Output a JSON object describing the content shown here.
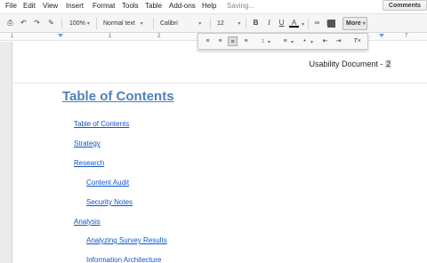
{
  "menu": [
    "File",
    "Edit",
    "View",
    "Insert",
    "Format",
    "Tools",
    "Table",
    "Add-ons",
    "Help"
  ],
  "status": "Saving...",
  "comments_label": "Comments",
  "toolbar": {
    "zoom": "100%",
    "style": "Normal text",
    "font": "Calibri",
    "size": "12",
    "more_label": "More",
    "bold": "B",
    "italic": "I",
    "underline": "U",
    "text_color": "A"
  },
  "ruler": {
    "ticks": [
      "1",
      "1",
      "2",
      "7"
    ]
  },
  "document": {
    "header": "Usability Document - ",
    "header_page": "2",
    "toc_title": "Table of Contents",
    "toc_items": [
      {
        "label": "Table of Contents",
        "level": 1
      },
      {
        "label": "Strategy",
        "level": 1
      },
      {
        "label": "Research",
        "level": 1
      },
      {
        "label": "Content Audit",
        "level": 2
      },
      {
        "label": "Security Notes",
        "level": 2
      },
      {
        "label": "Analysis",
        "level": 1
      },
      {
        "label": "Analyzing Survey Results",
        "level": 2
      },
      {
        "label": "Information Architecture",
        "level": 2
      }
    ]
  },
  "colors": {
    "heading": "#4f81bd",
    "link": "#1155cc"
  }
}
